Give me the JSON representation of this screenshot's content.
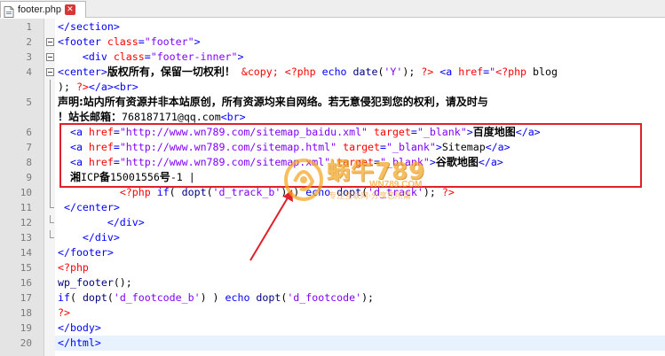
{
  "tab": {
    "filename": "footer.php",
    "close_glyph": "✕"
  },
  "lines": [
    {
      "n": "1",
      "segs": [
        [
          "t-tag",
          "</section>"
        ]
      ]
    },
    {
      "n": "2",
      "segs": [
        [
          "t-tag",
          "<footer "
        ],
        [
          "t-attr",
          "class"
        ],
        [
          "t-tag",
          "="
        ],
        [
          "t-str",
          "\"footer\""
        ],
        [
          "t-tag",
          ">"
        ]
      ]
    },
    {
      "n": "3",
      "segs": [
        [
          "t-ws",
          "    "
        ],
        [
          "t-tag",
          "<div "
        ],
        [
          "t-attr",
          "class"
        ],
        [
          "t-tag",
          "="
        ],
        [
          "t-str",
          "\"footer-inner\""
        ],
        [
          "t-tag",
          ">"
        ]
      ]
    },
    {
      "n": "4",
      "segs": [
        [
          "t-tag",
          "<center>"
        ],
        [
          "t-cjk",
          "版权所有，保留一切权利！"
        ],
        [
          "t-plain",
          " "
        ],
        [
          "t-php",
          "&copy;"
        ],
        [
          "t-plain",
          " "
        ],
        [
          "t-php",
          "<?php"
        ],
        [
          "t-plain",
          " "
        ],
        [
          "t-kw",
          "echo"
        ],
        [
          "t-plain",
          " "
        ],
        [
          "t-fn",
          "date"
        ],
        [
          "t-plain",
          "("
        ],
        [
          "t-str",
          "'Y'"
        ],
        [
          "t-plain",
          "); "
        ],
        [
          "t-php",
          "?>"
        ],
        [
          "t-plain",
          " "
        ],
        [
          "t-tag",
          "<a "
        ],
        [
          "t-attr",
          "href"
        ],
        [
          "t-tag",
          "="
        ],
        [
          "t-str",
          "\""
        ],
        [
          "t-php",
          "<?php"
        ],
        [
          "t-plain",
          " blog"
        ]
      ]
    },
    {
      "n": "",
      "segs": [
        [
          "t-plain",
          "); "
        ],
        [
          "t-php",
          "?>"
        ],
        [
          "t-tag",
          "</a><br>"
        ]
      ]
    },
    {
      "n": "5",
      "segs": [
        [
          "t-cjk",
          "声明:站内所有资源并非本站原创，所有资源均来自网络。若无意侵犯到您的权利，请及时与"
        ]
      ]
    },
    {
      "n": "",
      "segs": [
        [
          "t-cjk",
          "！站长邮箱："
        ],
        [
          "t-plain",
          "768187171@qq.com"
        ],
        [
          "t-tag",
          "<br>"
        ]
      ]
    },
    {
      "n": "6",
      "segs": [
        [
          "t-plain",
          "| "
        ],
        [
          "t-tag",
          "<a "
        ],
        [
          "t-attr",
          "href"
        ],
        [
          "t-tag",
          "="
        ],
        [
          "t-str",
          "\"http://www.wn789.com/sitemap_baidu.xml\""
        ],
        [
          "t-plain",
          " "
        ],
        [
          "t-attr",
          "target"
        ],
        [
          "t-tag",
          "="
        ],
        [
          "t-str",
          "\"_blank\""
        ],
        [
          "t-tag",
          ">"
        ],
        [
          "t-cjk",
          "百度地图"
        ],
        [
          "t-tag",
          "</a>"
        ]
      ]
    },
    {
      "n": "7",
      "segs": [
        [
          "t-plain",
          "| "
        ],
        [
          "t-tag",
          "<a "
        ],
        [
          "t-attr",
          "href"
        ],
        [
          "t-tag",
          "="
        ],
        [
          "t-str",
          "\"http://www.wn789.com/sitemap.html\""
        ],
        [
          "t-plain",
          " "
        ],
        [
          "t-attr",
          "target"
        ],
        [
          "t-tag",
          "="
        ],
        [
          "t-str",
          "\"_blank\""
        ],
        [
          "t-tag",
          ">"
        ],
        [
          "t-plain",
          "Sitemap"
        ],
        [
          "t-tag",
          "</a>"
        ]
      ]
    },
    {
      "n": "8",
      "segs": [
        [
          "t-plain",
          "| "
        ],
        [
          "t-tag",
          "<a "
        ],
        [
          "t-attr",
          "href"
        ],
        [
          "t-tag",
          "="
        ],
        [
          "t-str",
          "\"http://www.wn789.com/sitemap.xml\""
        ],
        [
          "t-plain",
          " "
        ],
        [
          "t-attr",
          "target"
        ],
        [
          "t-tag",
          "="
        ],
        [
          "t-str",
          "\"_blank\""
        ],
        [
          "t-tag",
          ">"
        ],
        [
          "t-cjk",
          "谷歌地图"
        ],
        [
          "t-tag",
          "</a>"
        ]
      ]
    },
    {
      "n": "9",
      "segs": [
        [
          "t-plain",
          "| "
        ],
        [
          "t-cjk",
          "湘"
        ],
        [
          "t-plain",
          "ICP"
        ],
        [
          "t-cjk",
          "备"
        ],
        [
          "t-plain",
          "15001556"
        ],
        [
          "t-cjk",
          "号"
        ],
        [
          "t-plain",
          "-1 |"
        ]
      ]
    },
    {
      "n": "10",
      "segs": [
        [
          "t-ws",
          "          "
        ],
        [
          "t-php",
          "<?php"
        ],
        [
          "t-plain",
          " "
        ],
        [
          "t-kw",
          "if"
        ],
        [
          "t-plain",
          "( "
        ],
        [
          "t-fn",
          "dopt"
        ],
        [
          "t-plain",
          "("
        ],
        [
          "t-str",
          "'d_track_b'"
        ],
        [
          "t-plain",
          ") ) "
        ],
        [
          "t-kw",
          "echo"
        ],
        [
          "t-plain",
          " "
        ],
        [
          "t-fn",
          "dopt"
        ],
        [
          "t-plain",
          "("
        ],
        [
          "t-str",
          "'d_track'"
        ],
        [
          "t-plain",
          "); "
        ],
        [
          "t-php",
          "?>"
        ]
      ]
    },
    {
      "n": "11",
      "segs": [
        [
          "t-plain",
          " "
        ],
        [
          "t-tag",
          "</center>"
        ]
      ]
    },
    {
      "n": "12",
      "segs": [
        [
          "t-ws",
          "        "
        ],
        [
          "t-tag",
          "</div>"
        ]
      ]
    },
    {
      "n": "13",
      "segs": [
        [
          "t-ws",
          "    "
        ],
        [
          "t-tag",
          "</div>"
        ]
      ]
    },
    {
      "n": "14",
      "segs": [
        [
          "t-tag",
          "</footer>"
        ]
      ]
    },
    {
      "n": "15",
      "segs": [
        [
          "t-php",
          "<?php"
        ]
      ]
    },
    {
      "n": "16",
      "segs": [
        [
          "t-fn",
          "wp_footer"
        ],
        [
          "t-plain",
          "();"
        ]
      ]
    },
    {
      "n": "17",
      "segs": [
        [
          "t-kw",
          "if"
        ],
        [
          "t-plain",
          "( "
        ],
        [
          "t-fn",
          "dopt"
        ],
        [
          "t-plain",
          "("
        ],
        [
          "t-str",
          "'d_footcode_b'"
        ],
        [
          "t-plain",
          ") ) "
        ],
        [
          "t-kw",
          "echo"
        ],
        [
          "t-plain",
          " "
        ],
        [
          "t-fn",
          "dopt"
        ],
        [
          "t-plain",
          "("
        ],
        [
          "t-str",
          "'d_footcode'"
        ],
        [
          "t-plain",
          ");"
        ]
      ]
    },
    {
      "n": "18",
      "segs": [
        [
          "t-php",
          "?>"
        ]
      ]
    },
    {
      "n": "19",
      "segs": [
        [
          "t-tag",
          "</body>"
        ]
      ]
    },
    {
      "n": "20",
      "segs": [
        [
          "t-tag",
          "</html>"
        ]
      ]
    }
  ],
  "current_line": "20",
  "annotation": {
    "box_color": "#e0202a",
    "arrow_color": "#e0202a"
  },
  "watermark": {
    "title": "蜗牛789",
    "url": "WN789.COM",
    "slogan": "专注互联网·分享您所需",
    "color": "#f5a623"
  }
}
